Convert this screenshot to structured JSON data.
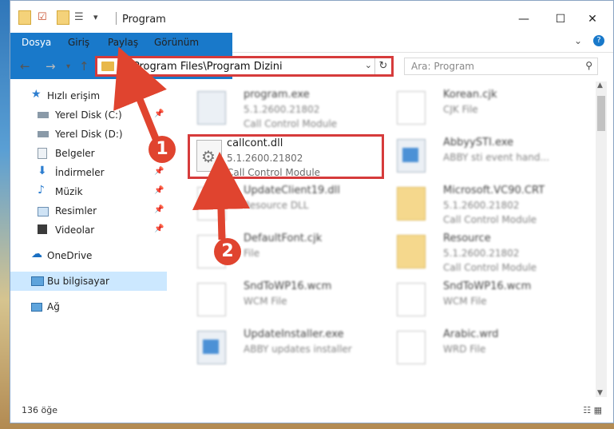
{
  "window": {
    "title": "Program",
    "controls": {
      "minimize": "—",
      "maximize": "☐",
      "close": "✕"
    }
  },
  "ribbon": {
    "tabs": [
      "Dosya",
      "Giriş",
      "Paylaş",
      "Görünüm"
    ]
  },
  "nav": {
    "address_path": "C:\\Program Files\\Program Dizini",
    "search_placeholder": "Ara: Program"
  },
  "sidebar": {
    "items": [
      {
        "label": "Hızlı erişim"
      },
      {
        "label": "Yerel Disk (C:)"
      },
      {
        "label": "Yerel Disk (D:)"
      },
      {
        "label": "Belgeler"
      },
      {
        "label": "İndirmeler"
      },
      {
        "label": "Müzik"
      },
      {
        "label": "Resimler"
      },
      {
        "label": "Videolar"
      },
      {
        "label": "OneDrive"
      },
      {
        "label": "Bu bilgisayar"
      },
      {
        "label": "Ağ"
      }
    ]
  },
  "files": [
    {
      "name": "program.exe",
      "version": "5.1.2600.21802",
      "desc": "Call Control Module"
    },
    {
      "name": "Korean.cjk",
      "version": "",
      "desc": "CJK File"
    },
    {
      "name": "callcont.dll",
      "version": "5.1.2600.21802",
      "desc": "Call Control Module"
    },
    {
      "name": "AbbyySTI.exe",
      "version": "",
      "desc": "ABBY sti event hand..."
    },
    {
      "name": "UpdateClient19.dll",
      "version": "",
      "desc": "Resource DLL"
    },
    {
      "name": "Microsoft.VC90.CRT",
      "version": "5.1.2600.21802",
      "desc": "Call Control Module"
    },
    {
      "name": "DefaultFont.cjk",
      "version": "",
      "desc": "File"
    },
    {
      "name": "Resource",
      "version": "5.1.2600.21802",
      "desc": "Call Control Module"
    },
    {
      "name": "SndToWP16.wcm",
      "version": "",
      "desc": "WCM File"
    },
    {
      "name": "SndToWP16.wcm",
      "version": "",
      "desc": "WCM File"
    },
    {
      "name": "UpdateInstaller.exe",
      "version": "",
      "desc": "ABBY updates installer"
    },
    {
      "name": "Arabic.wrd",
      "version": "",
      "desc": "WRD File"
    }
  ],
  "status": {
    "count": "136 öğe"
  },
  "markers": [
    "1",
    "2"
  ],
  "colors": {
    "accent": "#1979ca",
    "highlight": "#d63b3b"
  }
}
